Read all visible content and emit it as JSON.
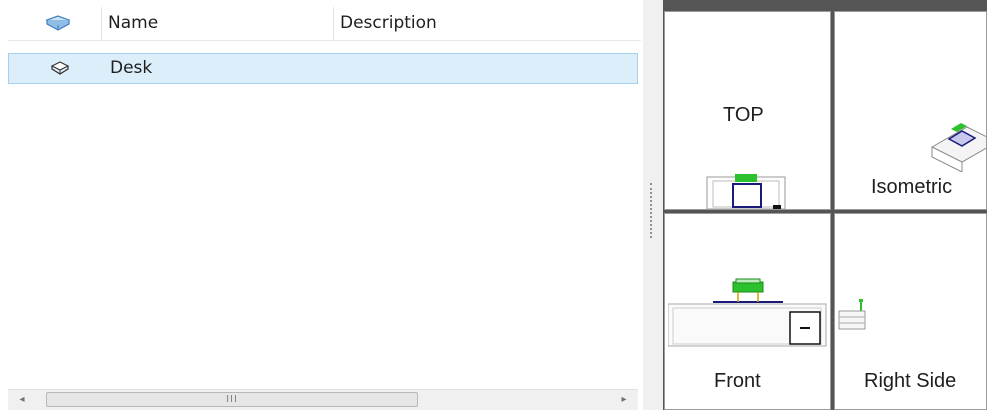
{
  "list": {
    "columns": {
      "name": "Name",
      "description": "Description"
    },
    "header_icon": "book-icon",
    "rows": [
      {
        "icon": "component-icon",
        "name": "Desk",
        "description": ""
      }
    ],
    "scrollbar": {
      "left_arrow": "◂",
      "right_arrow": "▸",
      "thumb_grip": "III"
    }
  },
  "views": {
    "top": "TOP",
    "isometric": "Isometric",
    "front": "Front",
    "right_side": "Right Side"
  },
  "colors": {
    "selection": "#ddeefb",
    "selection_border": "#a6d0f0",
    "view_gap": "#555555",
    "green": "#2ec12e",
    "navy": "#1a1a7a"
  }
}
